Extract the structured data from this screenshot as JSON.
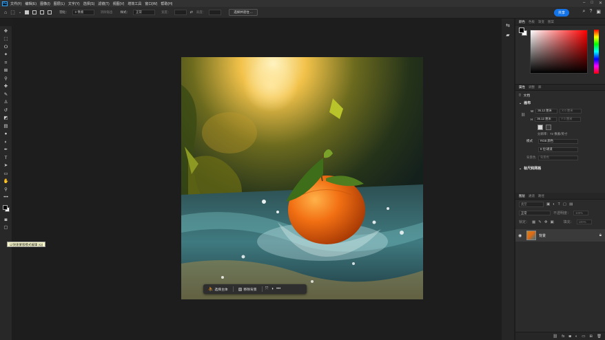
{
  "app": {
    "logo": "Ps"
  },
  "menu": [
    "文件(F)",
    "编辑(E)",
    "图像(I)",
    "图层(L)",
    "文字(Y)",
    "选择(S)",
    "滤镜(T)",
    "视图(V)",
    "增效工具",
    "窗口(W)",
    "帮助(H)"
  ],
  "options_bar": {
    "feather_label": "羽化：",
    "feather_value": "0 像素",
    "antialias_label": "消除锯齿",
    "style_label": "样式：",
    "style_value": "正常",
    "width_label": "宽度：",
    "height_label": "高度：",
    "select_mask_button": "选择并遮住 ...",
    "share_button": "共享"
  },
  "toolbar": {
    "tooltip": "以快速蒙版模式编辑 (Q)"
  },
  "contextual_taskbar": {
    "select_subject": "选择主体",
    "remove_background": "移除背景",
    "more": "•••"
  },
  "color_panel": {
    "tabs": [
      "颜色",
      "色板",
      "渐变",
      "图案"
    ],
    "accent_color": "#ff0000"
  },
  "properties_panel": {
    "tabs": [
      "属性",
      "调整",
      "库"
    ],
    "doc_label": "文档",
    "canvas_section": "画布",
    "width_value": "36.12 厘米",
    "height_value": "36.12 厘米",
    "x_placeholder": "X  0 厘米",
    "y_placeholder": "Y  0 厘米",
    "resolution_text": "分辨率：72 像素/英寸",
    "mode_label": "模式",
    "mode_value": "RGB 颜色",
    "depth_value": "8 位/通道",
    "bg_label": "背景色",
    "bg_value": "背景色",
    "rulers_section": "标尺和网格"
  },
  "layers_panel": {
    "tabs": [
      "图层",
      "通道",
      "路径"
    ],
    "search_placeholder": "类型",
    "blend_mode": "正常",
    "opacity_label": "不透明度：",
    "opacity_value": "100%",
    "lock_label": "锁定：",
    "fill_label": "填充：",
    "fill_value": "100%",
    "layer_name": "背景"
  }
}
